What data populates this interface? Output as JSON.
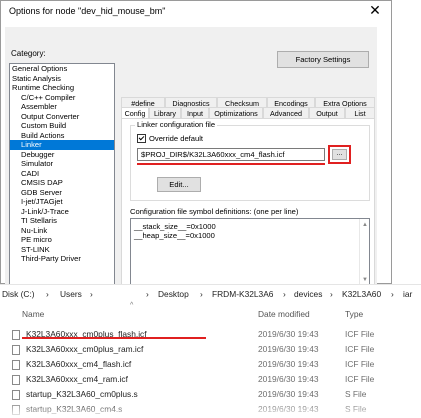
{
  "dialog": {
    "title": "Options for node \"dev_hid_mouse_bm\"",
    "close_glyph": "✕",
    "category_label": "Category:",
    "factory_button": "Factory Settings",
    "categories": [
      {
        "label": "General Options",
        "indent": false,
        "selected": false
      },
      {
        "label": "Static Analysis",
        "indent": false,
        "selected": false
      },
      {
        "label": "Runtime Checking",
        "indent": false,
        "selected": false
      },
      {
        "label": "C/C++ Compiler",
        "indent": true,
        "selected": false
      },
      {
        "label": "Assembler",
        "indent": true,
        "selected": false
      },
      {
        "label": "Output Converter",
        "indent": true,
        "selected": false
      },
      {
        "label": "Custom Build",
        "indent": true,
        "selected": false
      },
      {
        "label": "Build Actions",
        "indent": true,
        "selected": false
      },
      {
        "label": "Linker",
        "indent": true,
        "selected": true
      },
      {
        "label": "Debugger",
        "indent": true,
        "selected": false
      },
      {
        "label": "Simulator",
        "indent": true,
        "selected": false
      },
      {
        "label": "CADI",
        "indent": true,
        "selected": false
      },
      {
        "label": "CMSIS DAP",
        "indent": true,
        "selected": false
      },
      {
        "label": "GDB Server",
        "indent": true,
        "selected": false
      },
      {
        "label": "I-jet/JTAGjet",
        "indent": true,
        "selected": false
      },
      {
        "label": "J-Link/J-Trace",
        "indent": true,
        "selected": false
      },
      {
        "label": "TI Stellaris",
        "indent": true,
        "selected": false
      },
      {
        "label": "Nu-Link",
        "indent": true,
        "selected": false
      },
      {
        "label": "PE micro",
        "indent": true,
        "selected": false
      },
      {
        "label": "ST-LINK",
        "indent": true,
        "selected": false
      },
      {
        "label": "Third-Party Driver",
        "indent": true,
        "selected": false
      }
    ],
    "tabs_row1": [
      "#define",
      "Diagnostics",
      "Checksum",
      "Encodings",
      "Extra Options"
    ],
    "tabs_row2": [
      "Config",
      "Library",
      "Input",
      "Optimizations",
      "Advanced",
      "Output",
      "List"
    ],
    "active_tab": "Config",
    "linker_group_title": "Linker configuration file",
    "override_label": "Override default",
    "override_checked": true,
    "config_path": "$PROJ_DIR$/K32L3A60xxx_cm4_flash.icf",
    "browse_label": "...",
    "edit_button": "Edit...",
    "defs_label": "Configuration file symbol definitions: (one per line)",
    "defs_lines": [
      "__stack_size__=0x1000",
      "__heap_size__=0x1000"
    ]
  },
  "explorer": {
    "breadcrumb": [
      {
        "text": "Disk (C:)"
      },
      {
        "text": "›"
      },
      {
        "text": "Users"
      },
      {
        "text": "›"
      },
      {
        "text": "›"
      },
      {
        "text": "Desktop"
      },
      {
        "text": "›"
      },
      {
        "text": "FRDM-K32L3A6"
      },
      {
        "text": "›"
      },
      {
        "text": "devices"
      },
      {
        "text": "›"
      },
      {
        "text": "K32L3A60"
      },
      {
        "text": "›"
      },
      {
        "text": "iar"
      }
    ],
    "columns": {
      "name": "Name",
      "date": "Date modified",
      "type": "Type",
      "sort_glyph": "^"
    },
    "files": [
      {
        "name": "K32L3A60xxx_cm0plus_flash.icf",
        "date": "2019/6/30 19:43",
        "type": "ICF File"
      },
      {
        "name": "K32L3A60xxx_cm0plus_ram.icf",
        "date": "2019/6/30 19:43",
        "type": "ICF File"
      },
      {
        "name": "K32L3A60xxx_cm4_flash.icf",
        "date": "2019/6/30 19:43",
        "type": "ICF File"
      },
      {
        "name": "K32L3A60xxx_cm4_ram.icf",
        "date": "2019/6/30 19:43",
        "type": "ICF File"
      },
      {
        "name": "startup_K32L3A60_cm0plus.s",
        "date": "2019/6/30 19:43",
        "type": "S File"
      },
      {
        "name": "startup_K32L3A60_cm4.s",
        "date": "2019/6/30 19:43",
        "type": "S File"
      }
    ]
  },
  "colors": {
    "highlight_red": "#e02020",
    "selection_blue": "#0078d7"
  }
}
